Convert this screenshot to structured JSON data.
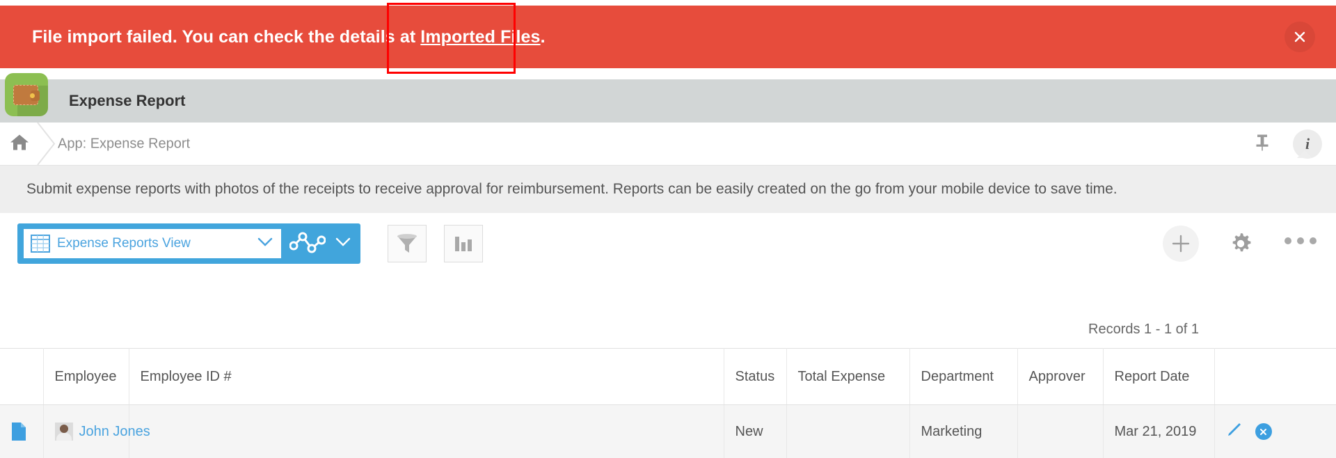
{
  "banner": {
    "message_prefix": "File import failed. You can check the details at",
    "link_text": "Imported Files",
    "message_suffix": ".",
    "close_label": "close-icon",
    "background_color": "#e74c3c"
  },
  "titlebar": {
    "app_name": "Expense Report",
    "icon_name": "wallet-app-icon",
    "background_color": "#d2d6d6"
  },
  "breadcrumb": {
    "home_icon": "home-icon",
    "path_label": "App: Expense Report",
    "pin_icon": "pin-icon",
    "info_icon": "info-icon"
  },
  "description": {
    "text": "Submit expense reports with photos of the receipts to receive approval for reimbursement. Reports can be easily created on the go from your mobile device to save time."
  },
  "toolbar": {
    "view_selector": {
      "icon": "table-view-icon",
      "value": "Expense Reports View",
      "chevron": "chevron-down-icon"
    },
    "chart_toggle": {
      "icon": "line-chart-icon",
      "chevron": "chevron-down-icon"
    },
    "filter_button": "filter-icon",
    "chart_button": "bar-chart-icon",
    "add_button": "plus-icon",
    "settings_button": "gear-icon",
    "more_button": "more-options-icon",
    "accent_color": "#41a5dc"
  },
  "records": {
    "count_text": "Records 1 - 1 of 1"
  },
  "table": {
    "columns": [
      "",
      "Employee",
      "Employee ID #",
      "Status",
      "Total Expense",
      "Department",
      "Approver",
      "Report Date",
      ""
    ],
    "rows": [
      {
        "doc_icon": "document-icon",
        "employee": "John Jones",
        "employee_id": "",
        "status": "New",
        "total_expense": "",
        "department": "Marketing",
        "approver": "",
        "report_date": "Mar 21, 2019",
        "edit_icon": "pencil-edit-icon",
        "delete_icon": "delete-x-icon"
      }
    ]
  }
}
